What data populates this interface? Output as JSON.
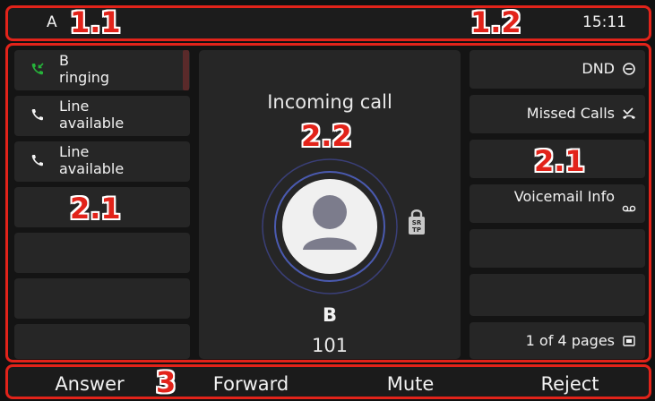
{
  "top_bar": {
    "account": "A",
    "time": "15:11"
  },
  "annotations": {
    "top_left": "1.1",
    "top_right": "1.2",
    "left_keys": "2.1",
    "center": "2.2",
    "right_keys": "2.1",
    "soft_keys": "3"
  },
  "line_keys": [
    {
      "line1": "B",
      "line2": "ringing",
      "icon": "incoming-call-icon",
      "status_color": "#26b33a"
    },
    {
      "line1": "Line",
      "line2": "available",
      "icon": "phone-icon"
    },
    {
      "line1": "Line",
      "line2": "available",
      "icon": "phone-icon"
    }
  ],
  "call": {
    "status": "Incoming call",
    "name": "B",
    "number": "101",
    "security_badge": "SRTP"
  },
  "function_keys": [
    {
      "label": "DND",
      "icon": "minus-circle-icon"
    },
    {
      "label": "Missed Calls",
      "icon": "missed-call-icon"
    },
    {
      "label": "",
      "icon": ""
    },
    {
      "label": "Voicemail Info",
      "icon": "voicemail-icon"
    },
    {
      "label": "",
      "icon": ""
    },
    {
      "label": "",
      "icon": ""
    },
    {
      "label": "1 of 4 pages",
      "icon": "page-icon"
    }
  ],
  "soft_keys": [
    "Answer",
    "Forward",
    "Mute",
    "Reject"
  ],
  "colors": {
    "highlight": "#e2231a",
    "ring_active": "#26b33a",
    "ringing_bar": "#5a2a2a"
  }
}
